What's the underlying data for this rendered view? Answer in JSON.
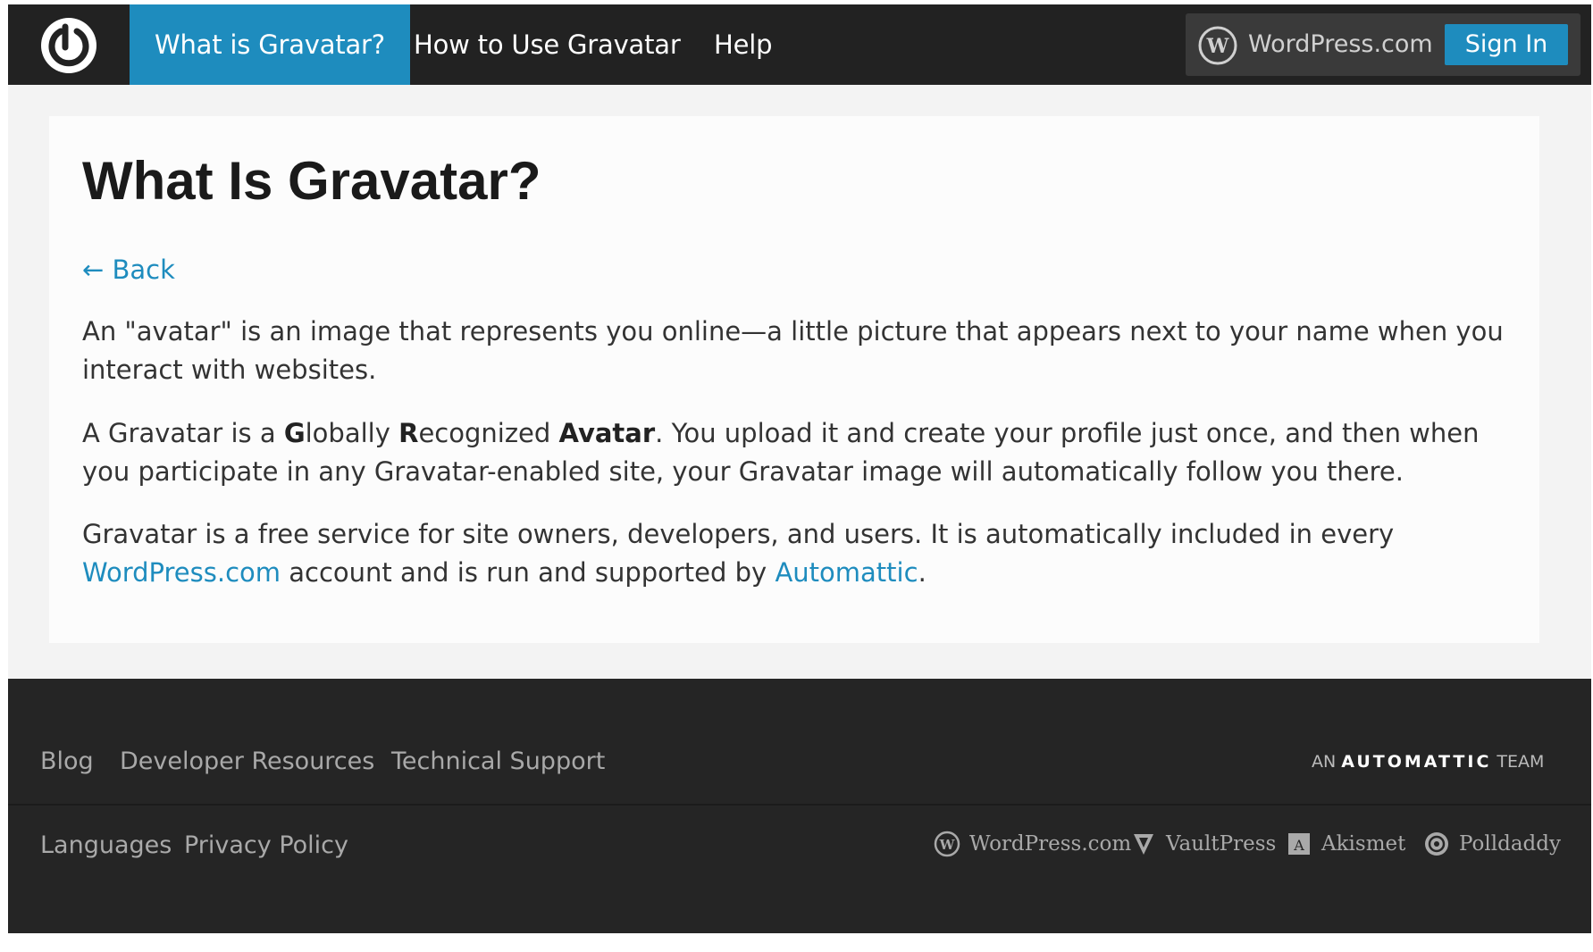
{
  "header": {
    "logo_icon": "gravatar-power-logo",
    "nav": [
      {
        "label": "What is Gravatar?",
        "active": true
      },
      {
        "label": "How to Use Gravatar",
        "active": false
      },
      {
        "label": "Help",
        "active": false
      }
    ],
    "wordpress_label": "WordPress.com",
    "signin_label": "Sign In"
  },
  "main": {
    "title": "What Is Gravatar?",
    "back_label": "← Back",
    "p1": "An \"avatar\" is an image that represents you online—a little picture that appears next to your name when you interact with websites.",
    "p2": {
      "pre": "A Gravatar is a ",
      "g": "G",
      "mid1": "lobally ",
      "r": "R",
      "mid2": "ecognized ",
      "avatar": "Avatar",
      "post": ". You upload it and create your profile just once, and then when you participate in any Gravatar-enabled site, your Gravatar image will automatically follow you there."
    },
    "p3": {
      "pre": "Gravatar is a free service for site owners, developers, and users. It is automatically included in every ",
      "link1": "WordPress.com",
      "mid": " account and is run and supported by ",
      "link2": "Automattic",
      "post": "."
    }
  },
  "footer": {
    "links_row1": [
      "Blog",
      "Developer Resources",
      "Technical Support"
    ],
    "links_row2": [
      "Languages",
      "Privacy Policy"
    ],
    "automattic": {
      "an": "AN",
      "brand": "AUTOMATTIC",
      "team": "TEAM"
    },
    "family": [
      {
        "label": "WordPress.com",
        "icon": "wordpress-icon"
      },
      {
        "label": "VaultPress",
        "icon": "vaultpress-icon"
      },
      {
        "label": "Akismet",
        "icon": "akismet-icon"
      },
      {
        "label": "Polldaddy",
        "icon": "polldaddy-icon"
      }
    ]
  },
  "colors": {
    "accent": "#1e8cbe",
    "header_bg": "#222222",
    "footer_bg": "#252525",
    "page_bg": "#f3f3f3"
  }
}
